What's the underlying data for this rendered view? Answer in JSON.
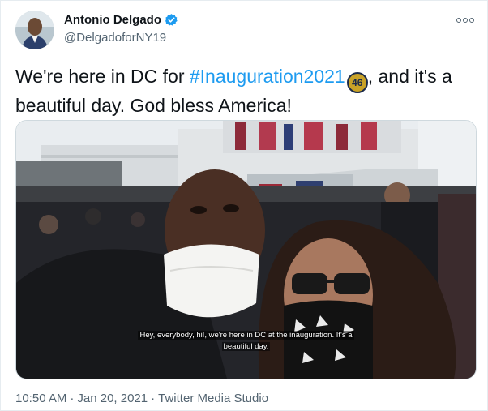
{
  "author": {
    "name": "Antonio Delgado",
    "handle": "@DelgadoforNY19",
    "verified_color": "#1d9bf0"
  },
  "tweet": {
    "text_before": "We're here in DC for ",
    "hashtag": "#Inauguration2021",
    "hashtag_emoji": "46",
    "text_after": ", and it's a beautiful day. God bless America!"
  },
  "media": {
    "caption_line1": "Hey, everybody, hi!, we're here in DC at the inauguration. It's a",
    "caption_line2": "beautiful day."
  },
  "meta": {
    "time": "10:50 AM",
    "separator1": "·",
    "date": "Jan 20, 2021",
    "separator2": "·",
    "source": "Twitter Media Studio"
  },
  "colors": {
    "link": "#1d9bf0",
    "secondary_text": "#536471"
  },
  "icons": {
    "more": "more-icon",
    "verified": "verified-badge-icon"
  }
}
